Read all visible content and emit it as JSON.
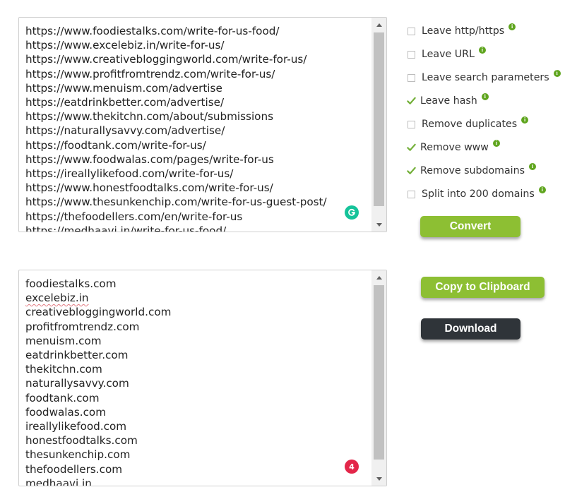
{
  "input": {
    "lines": [
      "https://www.foodiestalks.com/write-for-us-food/",
      "https://www.excelebiz.in/write-for-us/",
      "https://www.creativebloggingworld.com/write-for-us/",
      "https://www.profitfromtrendz.com/write-for-us/",
      "https://www.menuism.com/advertise",
      "https://eatdrinkbetter.com/advertise/",
      "https://www.thekitchn.com/about/submissions",
      "https://naturallysavvy.com/advertise/",
      "https://foodtank.com/write-for-us/",
      "https://www.foodwalas.com/pages/write-for-us",
      "https://ireallylikefood.com/write-for-us/",
      "https://www.honestfoodtalks.com/write-for-us/",
      "https://www.thesunkenchip.com/write-for-us-guest-post/",
      "https://thefoodellers.com/en/write-for-us",
      "https://medhaavi.in/write-for-us-food/"
    ]
  },
  "output": {
    "lines": [
      "foodiestalks.com",
      "excelebiz.in",
      "creativebloggingworld.com",
      "profitfromtrendz.com",
      "menuism.com",
      "eatdrinkbetter.com",
      "thekitchn.com",
      "naturallysavvy.com",
      "foodtank.com",
      "foodwalas.com",
      "ireallylikefood.com",
      "honestfoodtalks.com",
      "thesunkenchip.com",
      "thefoodellers.com",
      "medhaavi.in"
    ],
    "issue_count": "4"
  },
  "options": [
    {
      "label": "Leave http/https",
      "checked": false
    },
    {
      "label": "Leave URL",
      "checked": false
    },
    {
      "label": "Leave search parameters",
      "checked": false
    },
    {
      "label": "Leave hash",
      "checked": true
    },
    {
      "label": "Remove duplicates",
      "checked": false
    },
    {
      "label": "Remove www",
      "checked": true
    },
    {
      "label": "Remove subdomains",
      "checked": true
    },
    {
      "label": "Split into 200 domains",
      "checked": false
    }
  ],
  "info_glyph": "i",
  "buttons": {
    "convert": "Convert",
    "copy": "Copy to Clipboard",
    "download": "Download"
  },
  "colors": {
    "accent_green": "#8dbf33",
    "dark_button": "#2f3439",
    "grammarly": "#15c39a",
    "badge_red": "#e32649"
  },
  "icons": {
    "grammarly": "grammarly-icon",
    "check": "checkmark-icon",
    "info": "info-icon"
  }
}
